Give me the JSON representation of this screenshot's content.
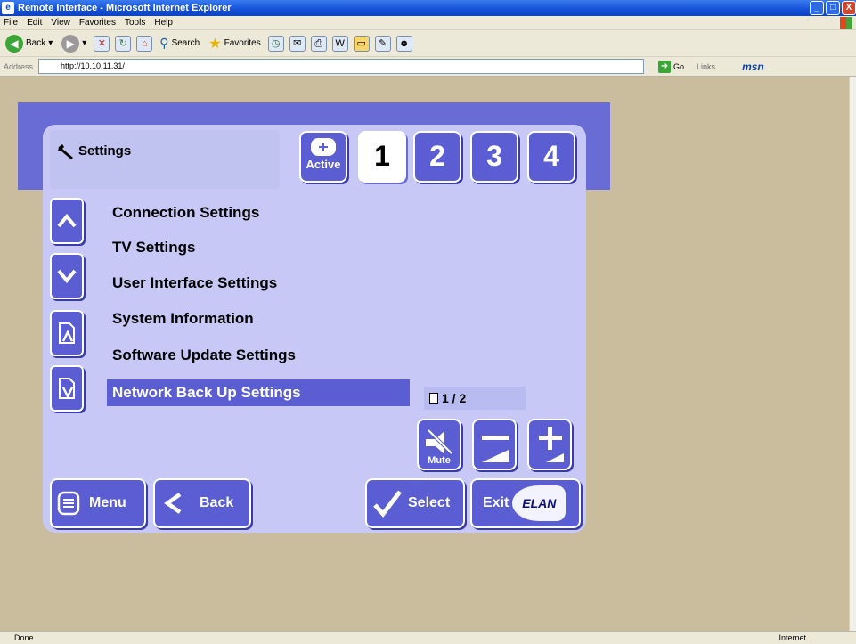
{
  "window": {
    "title": "Remote Interface - Microsoft Internet Explorer",
    "min": "_",
    "max": "□",
    "close": "X"
  },
  "menubar": [
    "File",
    "Edit",
    "View",
    "Favorites",
    "Tools",
    "Help"
  ],
  "toolbar": {
    "back": "Back",
    "search": "Search",
    "favorites": "Favorites"
  },
  "address": {
    "label": "Address",
    "url": "http://10.10.11.31/",
    "go": "Go",
    "links": "Links",
    "msn": "msn"
  },
  "status": {
    "left": "Done",
    "zone": "Internet"
  },
  "remote": {
    "title": "Settings",
    "active_label": "Active",
    "tabs": [
      "1",
      "2",
      "3",
      "4"
    ],
    "selected_tab": "1",
    "items": [
      "Connection Settings",
      "TV Settings",
      "User Interface Settings",
      "System Information",
      "Software Update Settings",
      "Network Back Up Settings"
    ],
    "highlighted_item": "Network Back Up Settings",
    "page_indicator": "1 / 2",
    "mute_label": "Mute",
    "menu_label": "Menu",
    "back_label": "Back",
    "select_label": "Select",
    "exit_label": "Exit",
    "logo_text": "ELAN",
    "colors": {
      "button": "#5a5ed2",
      "panel": "#c8c8f7",
      "band": "#6a6cd5",
      "desktop": "#c9bd9e"
    }
  }
}
